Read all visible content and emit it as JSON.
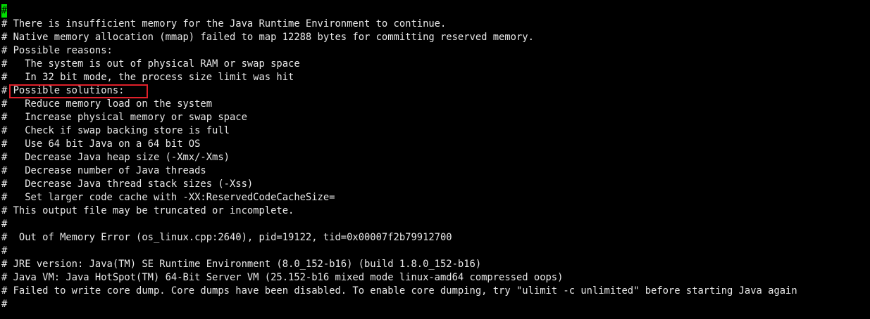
{
  "terminal": {
    "cursor_char": "#",
    "first_line_rest": "",
    "lines": [
      "# There is insufficient memory for the Java Runtime Environment to continue.",
      "# Native memory allocation (mmap) failed to map 12288 bytes for committing reserved memory.",
      "# Possible reasons:",
      "#   The system is out of physical RAM or swap space",
      "#   In 32 bit mode, the process size limit was hit",
      "# Possible solutions:",
      "#   Reduce memory load on the system",
      "#   Increase physical memory or swap space",
      "#   Check if swap backing store is full",
      "#   Use 64 bit Java on a 64 bit OS",
      "#   Decrease Java heap size (-Xmx/-Xms)",
      "#   Decrease number of Java threads",
      "#   Decrease Java thread stack sizes (-Xss)",
      "#   Set larger code cache with -XX:ReservedCodeCacheSize=",
      "# This output file may be truncated or incomplete.",
      "#",
      "#  Out of Memory Error (os_linux.cpp:2640), pid=19122, tid=0x00007f2b79912700",
      "#",
      "# JRE version: Java(TM) SE Runtime Environment (8.0_152-b16) (build 1.8.0_152-b16)",
      "# Java VM: Java HotSpot(TM) 64-Bit Server VM (25.152-b16 mixed mode linux-amd64 compressed oops)",
      "# Failed to write core dump. Core dumps have been disabled. To enable core dumping, try \"ulimit -c unlimited\" before starting Java again",
      "#"
    ]
  },
  "colors": {
    "background": "#000000",
    "text": "#e8e8e8",
    "cursor": "#00dd00",
    "highlight_box": "#e0202a"
  }
}
